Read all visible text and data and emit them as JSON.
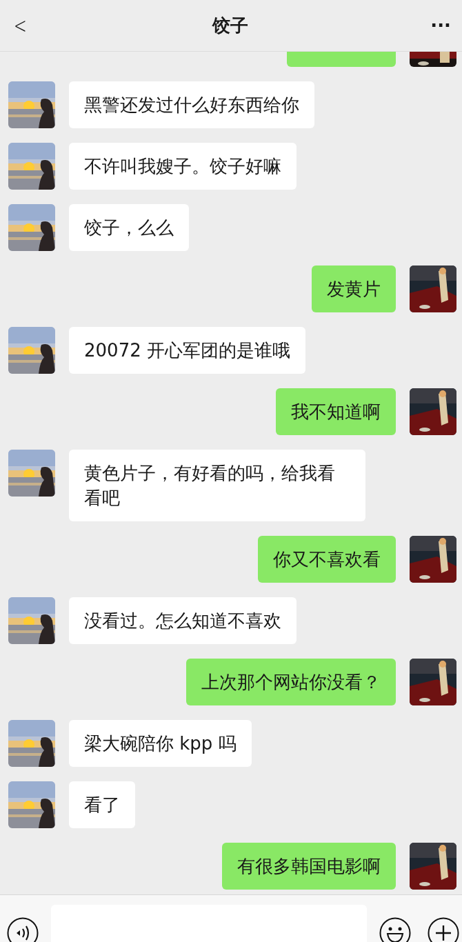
{
  "header": {
    "back": "<",
    "title": "饺子",
    "more": "···"
  },
  "messages": [
    {
      "outgoing": true,
      "kind": "cut"
    },
    {
      "outgoing": false,
      "kind": "text",
      "text": "黑警还发过什么好东西给你"
    },
    {
      "outgoing": false,
      "kind": "text",
      "text": "不许叫我嫂子。饺子好嘛"
    },
    {
      "outgoing": false,
      "kind": "text",
      "text": "饺子，么么"
    },
    {
      "outgoing": true,
      "kind": "text",
      "text": "发黄片"
    },
    {
      "outgoing": false,
      "kind": "text",
      "text": "20072 开心军团的是谁哦"
    },
    {
      "outgoing": true,
      "kind": "text",
      "text": "我不知道啊"
    },
    {
      "outgoing": false,
      "kind": "text",
      "text": "黄色片子，有好看的吗，给我看看吧"
    },
    {
      "outgoing": true,
      "kind": "text",
      "text": "你又不喜欢看"
    },
    {
      "outgoing": false,
      "kind": "text",
      "text": "没看过。怎么知道不喜欢"
    },
    {
      "outgoing": true,
      "kind": "text",
      "text": "上次那个网站你没看？"
    },
    {
      "outgoing": false,
      "kind": "text",
      "text": "梁大碗陪你 kpp 吗"
    },
    {
      "outgoing": false,
      "kind": "text",
      "text": "看了"
    },
    {
      "outgoing": true,
      "kind": "text",
      "text": "有很多韩国电影啊"
    }
  ]
}
